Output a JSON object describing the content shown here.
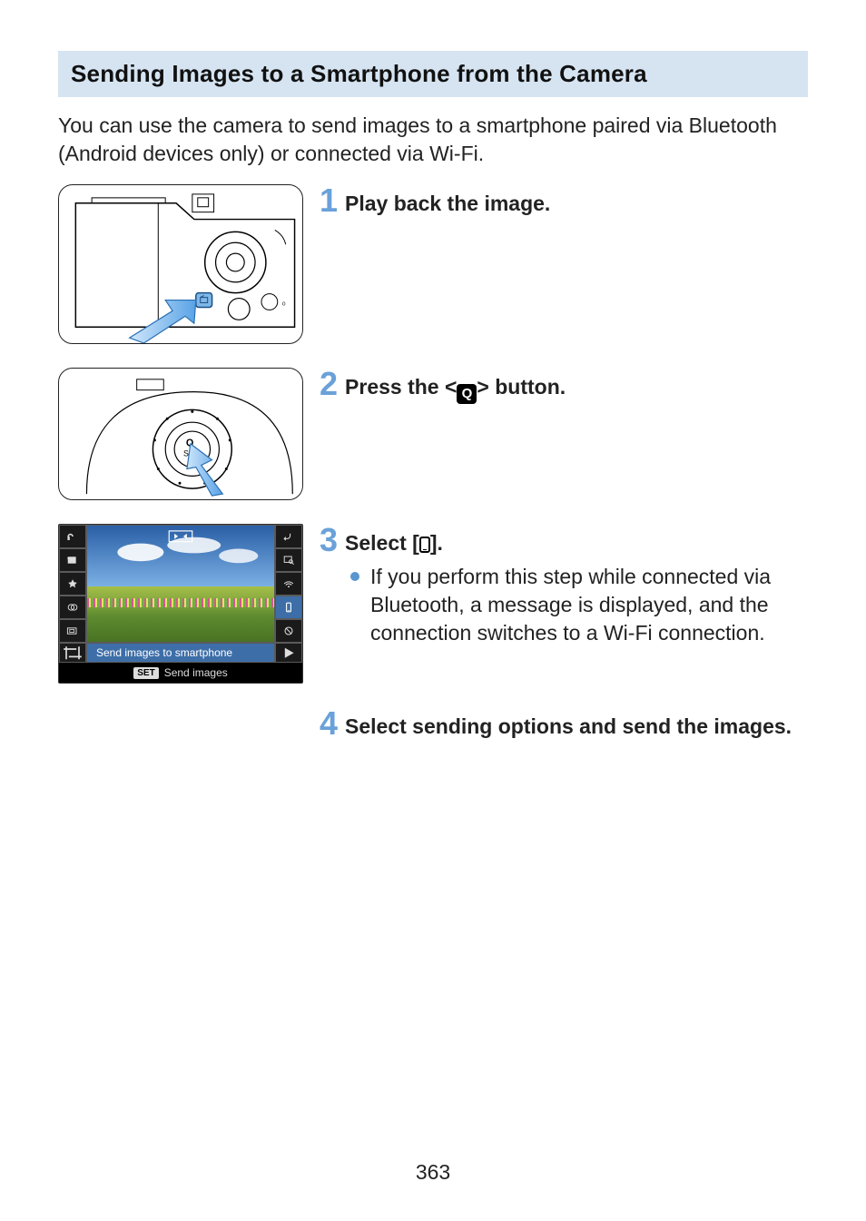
{
  "heading": "Sending Images to a Smartphone from the Camera",
  "intro": "You can use the camera to send images to a smartphone paired via Bluetooth (Android devices only) or connected via Wi-Fi.",
  "steps": {
    "s1": {
      "num": "1",
      "title": "Play back the image."
    },
    "s2": {
      "num": "2",
      "title_pre": "Press the <",
      "title_post": "> button."
    },
    "s3": {
      "num": "3",
      "title_pre": "Select [",
      "title_post": "].",
      "bullet1": "If you perform this step while connected via Bluetooth, a message is displayed, and the connection switches to a Wi-Fi connection."
    },
    "s4": {
      "num": "4",
      "title": "Select sending options and send the images."
    }
  },
  "lcd": {
    "label": "Send images to smartphone",
    "set_badge": "SET",
    "footer": "Send images"
  },
  "page_number": "363"
}
